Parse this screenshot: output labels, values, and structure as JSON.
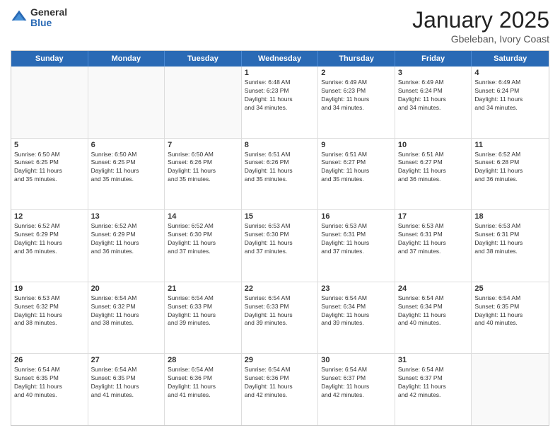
{
  "logo": {
    "general": "General",
    "blue": "Blue"
  },
  "header": {
    "month": "January 2025",
    "location": "Gbeleban, Ivory Coast"
  },
  "weekdays": [
    "Sunday",
    "Monday",
    "Tuesday",
    "Wednesday",
    "Thursday",
    "Friday",
    "Saturday"
  ],
  "rows": [
    [
      {
        "day": "",
        "info": ""
      },
      {
        "day": "",
        "info": ""
      },
      {
        "day": "",
        "info": ""
      },
      {
        "day": "1",
        "info": "Sunrise: 6:48 AM\nSunset: 6:23 PM\nDaylight: 11 hours\nand 34 minutes."
      },
      {
        "day": "2",
        "info": "Sunrise: 6:49 AM\nSunset: 6:23 PM\nDaylight: 11 hours\nand 34 minutes."
      },
      {
        "day": "3",
        "info": "Sunrise: 6:49 AM\nSunset: 6:24 PM\nDaylight: 11 hours\nand 34 minutes."
      },
      {
        "day": "4",
        "info": "Sunrise: 6:49 AM\nSunset: 6:24 PM\nDaylight: 11 hours\nand 34 minutes."
      }
    ],
    [
      {
        "day": "5",
        "info": "Sunrise: 6:50 AM\nSunset: 6:25 PM\nDaylight: 11 hours\nand 35 minutes."
      },
      {
        "day": "6",
        "info": "Sunrise: 6:50 AM\nSunset: 6:25 PM\nDaylight: 11 hours\nand 35 minutes."
      },
      {
        "day": "7",
        "info": "Sunrise: 6:50 AM\nSunset: 6:26 PM\nDaylight: 11 hours\nand 35 minutes."
      },
      {
        "day": "8",
        "info": "Sunrise: 6:51 AM\nSunset: 6:26 PM\nDaylight: 11 hours\nand 35 minutes."
      },
      {
        "day": "9",
        "info": "Sunrise: 6:51 AM\nSunset: 6:27 PM\nDaylight: 11 hours\nand 35 minutes."
      },
      {
        "day": "10",
        "info": "Sunrise: 6:51 AM\nSunset: 6:27 PM\nDaylight: 11 hours\nand 36 minutes."
      },
      {
        "day": "11",
        "info": "Sunrise: 6:52 AM\nSunset: 6:28 PM\nDaylight: 11 hours\nand 36 minutes."
      }
    ],
    [
      {
        "day": "12",
        "info": "Sunrise: 6:52 AM\nSunset: 6:29 PM\nDaylight: 11 hours\nand 36 minutes."
      },
      {
        "day": "13",
        "info": "Sunrise: 6:52 AM\nSunset: 6:29 PM\nDaylight: 11 hours\nand 36 minutes."
      },
      {
        "day": "14",
        "info": "Sunrise: 6:52 AM\nSunset: 6:30 PM\nDaylight: 11 hours\nand 37 minutes."
      },
      {
        "day": "15",
        "info": "Sunrise: 6:53 AM\nSunset: 6:30 PM\nDaylight: 11 hours\nand 37 minutes."
      },
      {
        "day": "16",
        "info": "Sunrise: 6:53 AM\nSunset: 6:31 PM\nDaylight: 11 hours\nand 37 minutes."
      },
      {
        "day": "17",
        "info": "Sunrise: 6:53 AM\nSunset: 6:31 PM\nDaylight: 11 hours\nand 37 minutes."
      },
      {
        "day": "18",
        "info": "Sunrise: 6:53 AM\nSunset: 6:31 PM\nDaylight: 11 hours\nand 38 minutes."
      }
    ],
    [
      {
        "day": "19",
        "info": "Sunrise: 6:53 AM\nSunset: 6:32 PM\nDaylight: 11 hours\nand 38 minutes."
      },
      {
        "day": "20",
        "info": "Sunrise: 6:54 AM\nSunset: 6:32 PM\nDaylight: 11 hours\nand 38 minutes."
      },
      {
        "day": "21",
        "info": "Sunrise: 6:54 AM\nSunset: 6:33 PM\nDaylight: 11 hours\nand 39 minutes."
      },
      {
        "day": "22",
        "info": "Sunrise: 6:54 AM\nSunset: 6:33 PM\nDaylight: 11 hours\nand 39 minutes."
      },
      {
        "day": "23",
        "info": "Sunrise: 6:54 AM\nSunset: 6:34 PM\nDaylight: 11 hours\nand 39 minutes."
      },
      {
        "day": "24",
        "info": "Sunrise: 6:54 AM\nSunset: 6:34 PM\nDaylight: 11 hours\nand 40 minutes."
      },
      {
        "day": "25",
        "info": "Sunrise: 6:54 AM\nSunset: 6:35 PM\nDaylight: 11 hours\nand 40 minutes."
      }
    ],
    [
      {
        "day": "26",
        "info": "Sunrise: 6:54 AM\nSunset: 6:35 PM\nDaylight: 11 hours\nand 40 minutes."
      },
      {
        "day": "27",
        "info": "Sunrise: 6:54 AM\nSunset: 6:35 PM\nDaylight: 11 hours\nand 41 minutes."
      },
      {
        "day": "28",
        "info": "Sunrise: 6:54 AM\nSunset: 6:36 PM\nDaylight: 11 hours\nand 41 minutes."
      },
      {
        "day": "29",
        "info": "Sunrise: 6:54 AM\nSunset: 6:36 PM\nDaylight: 11 hours\nand 42 minutes."
      },
      {
        "day": "30",
        "info": "Sunrise: 6:54 AM\nSunset: 6:37 PM\nDaylight: 11 hours\nand 42 minutes."
      },
      {
        "day": "31",
        "info": "Sunrise: 6:54 AM\nSunset: 6:37 PM\nDaylight: 11 hours\nand 42 minutes."
      },
      {
        "day": "",
        "info": ""
      }
    ]
  ]
}
